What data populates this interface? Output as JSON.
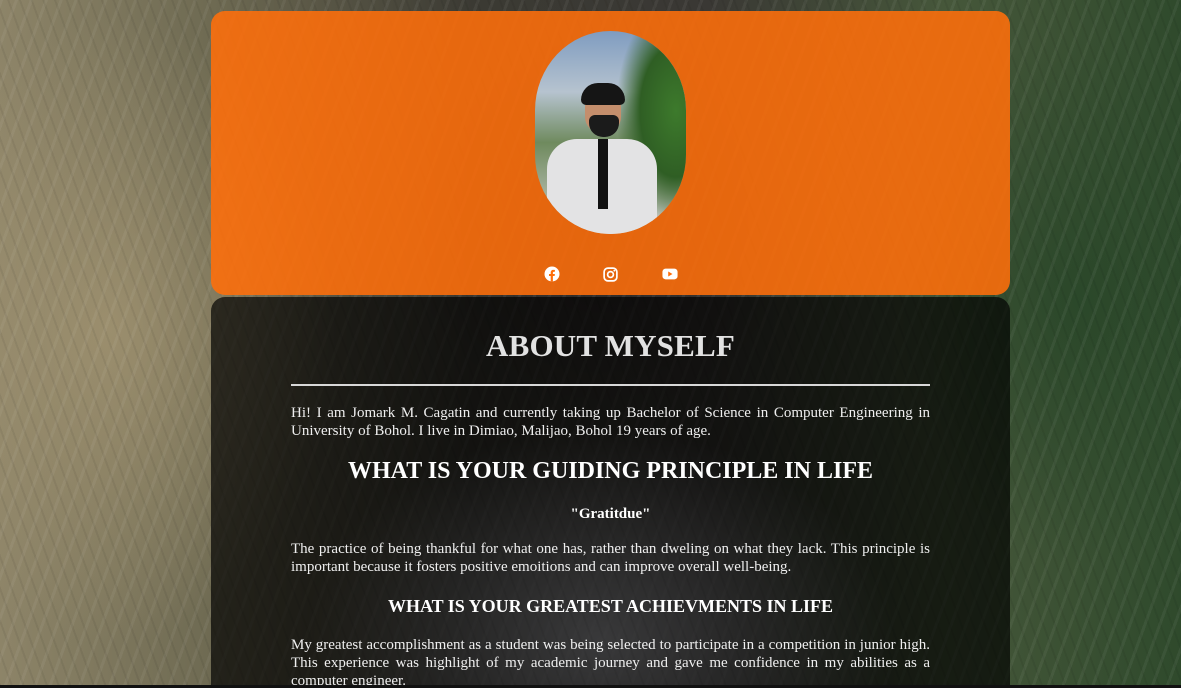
{
  "header": {
    "avatar_alt": "Profile photo",
    "socials": [
      {
        "name": "facebook-icon"
      },
      {
        "name": "instagram-icon"
      },
      {
        "name": "youtube-icon"
      }
    ],
    "accent_color": "#ff6e0a"
  },
  "about": {
    "title": "ABOUT MYSELF",
    "intro": "Hi! I am Jomark M. Cagatin and currently taking up Bachelor of Science in Computer Engineering in University of Bohol. I live in Dimiao, Malijao, Bohol 19 years of age.",
    "principle_heading": "WHAT IS YOUR GUIDING PRINCIPLE IN LIFE",
    "principle_quote": "\"Gratitdue\"",
    "principle_text": "The practice of being thankful for what one has, rather than dweling on what they lack. This principle is important because it fosters positive emoitions and can improve overall well-being.",
    "achievement_heading": "WHAT IS YOUR GREATEST ACHIEVMENTS IN LIFE",
    "achievement_text": "My greatest accomplishment as a student was being selected to participate in a competition in junior high. This experience was highlight of my academic journey and gave me confidence in my abilities as a computer engineer."
  }
}
